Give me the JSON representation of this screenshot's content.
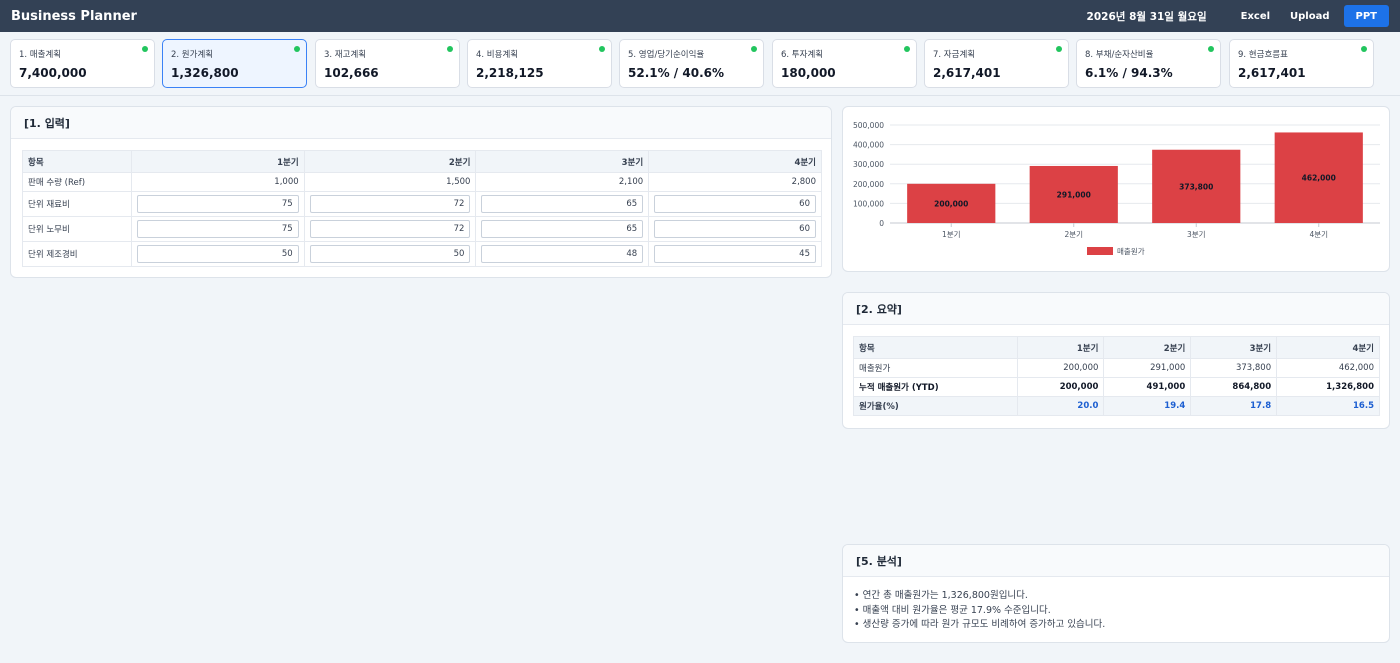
{
  "app": {
    "title": "Business Planner"
  },
  "header": {
    "date": "2026년 8월 31일 월요일",
    "buttons": [
      "Excel",
      "Upload",
      "PPT"
    ]
  },
  "kpis": [
    {
      "label": "1. 매출계획",
      "value": "7,400,000"
    },
    {
      "label": "2. 원가계획",
      "value": "1,326,800",
      "active": true
    },
    {
      "label": "3. 재고계획",
      "value": "102,666"
    },
    {
      "label": "4. 비용계획",
      "value": "2,218,125"
    },
    {
      "label": "5. 영업/당기순이익율",
      "value": "52.1% / 40.6%"
    },
    {
      "label": "6. 투자계획",
      "value": "180,000"
    },
    {
      "label": "7. 자금계획",
      "value": "2,617,401"
    },
    {
      "label": "8. 부채/순자산비율",
      "value": "6.1% / 94.3%"
    },
    {
      "label": "9. 현금흐름표",
      "value": "2,617,401"
    }
  ],
  "status_color": "#22c55e",
  "input": {
    "title": "[1. 입력]",
    "headers": [
      "항목",
      "1분기",
      "2분기",
      "3분기",
      "4분기"
    ],
    "ref_row": {
      "label": "판매 수량 (Ref)",
      "values": [
        "1,000",
        "1,500",
        "2,100",
        "2,800"
      ]
    },
    "rows": [
      {
        "label": "단위 재료비",
        "values": [
          "75",
          "72",
          "65",
          "60"
        ]
      },
      {
        "label": "단위 노무비",
        "values": [
          "75",
          "72",
          "65",
          "60"
        ]
      },
      {
        "label": "단위 제조경비",
        "values": [
          "50",
          "50",
          "48",
          "45"
        ]
      }
    ]
  },
  "chart_data": {
    "type": "bar",
    "categories": [
      "1분기",
      "2분기",
      "3분기",
      "4분기"
    ],
    "series": [
      {
        "name": "매출원가",
        "values": [
          200000,
          291000,
          373800,
          462000
        ],
        "color": "#dc4145"
      }
    ],
    "data_labels": [
      "200,000",
      "291,000",
      "373,800",
      "462,000"
    ],
    "y_ticks": [
      "0",
      "100,000",
      "200,000",
      "300,000",
      "400,000",
      "500,000"
    ],
    "ylim": [
      0,
      500000
    ],
    "grid": true,
    "legend": "bottom"
  },
  "summary": {
    "title": "[2. 요약]",
    "headers": [
      "항목",
      "1분기",
      "2분기",
      "3분기",
      "4분기"
    ],
    "rows": [
      {
        "label": "매출원가",
        "values": [
          "200,000",
          "291,000",
          "373,800",
          "462,000"
        ],
        "style": "normal"
      },
      {
        "label": "누적 매출원가 (YTD)",
        "values": [
          "200,000",
          "491,000",
          "864,800",
          "1,326,800"
        ],
        "style": "bold"
      },
      {
        "label": "원가율(%)",
        "values": [
          "20.0",
          "19.4",
          "17.8",
          "16.5"
        ],
        "style": "rate"
      }
    ]
  },
  "analysis": {
    "title": "[5. 분석]",
    "lines": [
      "• 연간 총 매출원가는 1,326,800원입니다.",
      "• 매출액 대비 원가율은 평균 17.9% 수준입니다.",
      "• 생산량 증가에 따라 원가 규모도 비례하여 증가하고 있습니다."
    ]
  }
}
